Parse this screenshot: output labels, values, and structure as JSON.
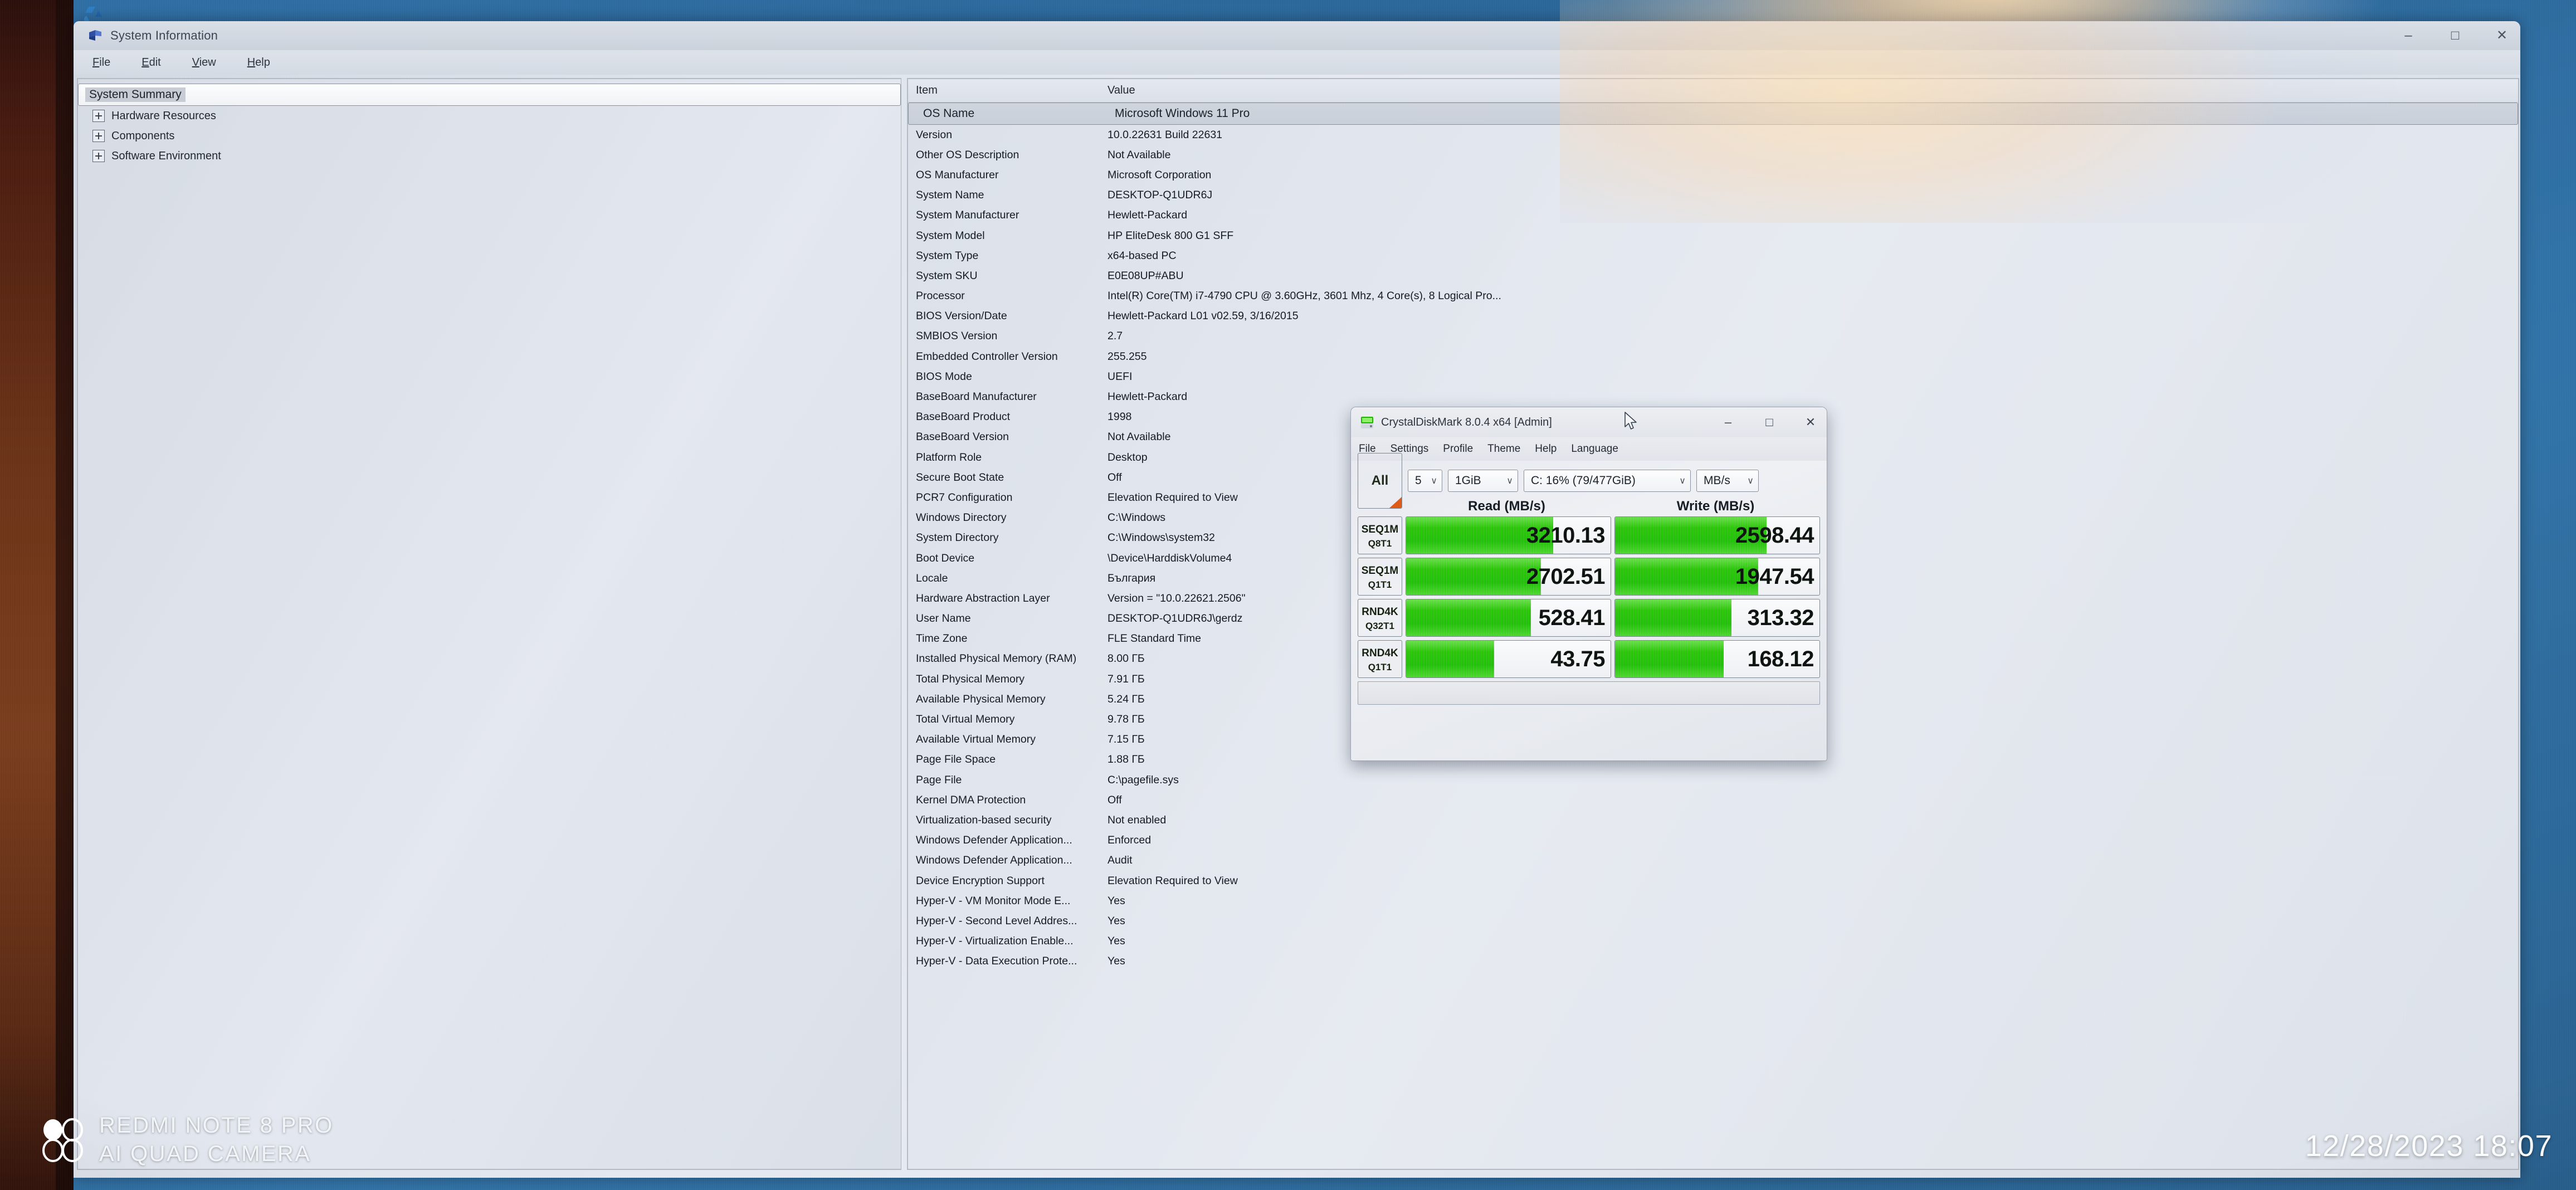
{
  "photo": {
    "watermark": {
      "line1": "REDMI NOTE 8 PRO",
      "line2": "AI QUAD CAMERA"
    },
    "timestamp": "12/28/2023 18:07",
    "desktop": {
      "recycle_bin_label": ""
    }
  },
  "sysinfo": {
    "title": "System Information",
    "menu": [
      {
        "label": "File",
        "accel": "F"
      },
      {
        "label": "Edit",
        "accel": "E"
      },
      {
        "label": "View",
        "accel": "V"
      },
      {
        "label": "Help",
        "accel": "H"
      }
    ],
    "window_controls": {
      "minimize": "–",
      "maximize": "□",
      "close": "✕"
    },
    "tree": [
      {
        "label": "System Summary",
        "selected": true,
        "expandable": false
      },
      {
        "label": "Hardware Resources",
        "selected": false,
        "expandable": true
      },
      {
        "label": "Components",
        "selected": false,
        "expandable": true
      },
      {
        "label": "Software Environment",
        "selected": false,
        "expandable": true
      }
    ],
    "columns": [
      "Item",
      "Value"
    ],
    "rows": [
      {
        "item": "OS Name",
        "value": "Microsoft Windows 11 Pro",
        "selected": true
      },
      {
        "item": "Version",
        "value": "10.0.22631 Build 22631"
      },
      {
        "item": "Other OS Description",
        "value": "Not Available"
      },
      {
        "item": "OS Manufacturer",
        "value": "Microsoft Corporation"
      },
      {
        "item": "System Name",
        "value": "DESKTOP-Q1UDR6J"
      },
      {
        "item": "System Manufacturer",
        "value": "Hewlett-Packard"
      },
      {
        "item": "System Model",
        "value": "HP EliteDesk 800 G1 SFF"
      },
      {
        "item": "System Type",
        "value": "x64-based PC"
      },
      {
        "item": "System SKU",
        "value": "E0E08UP#ABU"
      },
      {
        "item": "Processor",
        "value": "Intel(R) Core(TM) i7-4790 CPU @ 3.60GHz, 3601 Mhz, 4 Core(s), 8 Logical Pro..."
      },
      {
        "item": "BIOS Version/Date",
        "value": "Hewlett-Packard L01 v02.59, 3/16/2015"
      },
      {
        "item": "SMBIOS Version",
        "value": "2.7"
      },
      {
        "item": "Embedded Controller Version",
        "value": "255.255"
      },
      {
        "item": "BIOS Mode",
        "value": "UEFI"
      },
      {
        "item": "BaseBoard Manufacturer",
        "value": "Hewlett-Packard"
      },
      {
        "item": "BaseBoard Product",
        "value": "1998"
      },
      {
        "item": "BaseBoard Version",
        "value": "Not Available"
      },
      {
        "item": "Platform Role",
        "value": "Desktop"
      },
      {
        "item": "Secure Boot State",
        "value": "Off"
      },
      {
        "item": "PCR7 Configuration",
        "value": "Elevation Required to View"
      },
      {
        "item": "Windows Directory",
        "value": "C:\\Windows"
      },
      {
        "item": "System Directory",
        "value": "C:\\Windows\\system32"
      },
      {
        "item": "Boot Device",
        "value": "\\Device\\HarddiskVolume4"
      },
      {
        "item": "Locale",
        "value": "България"
      },
      {
        "item": "Hardware Abstraction Layer",
        "value": "Version = \"10.0.22621.2506\""
      },
      {
        "item": "User Name",
        "value": "DESKTOP-Q1UDR6J\\gerdz"
      },
      {
        "item": "Time Zone",
        "value": "FLE Standard Time"
      },
      {
        "item": "Installed Physical Memory (RAM)",
        "value": "8.00 ГБ"
      },
      {
        "item": "Total Physical Memory",
        "value": "7.91 ГБ"
      },
      {
        "item": "Available Physical Memory",
        "value": "5.24 ГБ"
      },
      {
        "item": "Total Virtual Memory",
        "value": "9.78 ГБ"
      },
      {
        "item": "Available Virtual Memory",
        "value": "7.15 ГБ"
      },
      {
        "item": "Page File Space",
        "value": "1.88 ГБ"
      },
      {
        "item": "Page File",
        "value": "C:\\pagefile.sys"
      },
      {
        "item": "Kernel DMA Protection",
        "value": "Off"
      },
      {
        "item": "Virtualization-based security",
        "value": "Not enabled"
      },
      {
        "item": "Windows Defender Application...",
        "value": "Enforced"
      },
      {
        "item": "Windows Defender Application...",
        "value": "Audit"
      },
      {
        "item": "Device Encryption Support",
        "value": "Elevation Required to View"
      },
      {
        "item": "Hyper-V - VM Monitor Mode E...",
        "value": "Yes"
      },
      {
        "item": "Hyper-V - Second Level Addres...",
        "value": "Yes"
      },
      {
        "item": "Hyper-V - Virtualization Enable...",
        "value": "Yes"
      },
      {
        "item": "Hyper-V - Data Execution Prote...",
        "value": "Yes"
      }
    ]
  },
  "crystaldiskmark": {
    "title": "CrystalDiskMark 8.0.4 x64 [Admin]",
    "menu": [
      "File",
      "Settings",
      "Profile",
      "Theme",
      "Help",
      "Language"
    ],
    "window_controls": {
      "minimize": "–",
      "maximize": "□",
      "close": "✕"
    },
    "toolbar": {
      "all_button": "All",
      "count": "5",
      "size": "1GiB",
      "drive": "C: 16% (79/477GiB)",
      "unit": "MB/s",
      "chevron": "∨"
    },
    "headers": {
      "read": "Read (MB/s)",
      "write": "Write (MB/s)"
    },
    "chart_data": {
      "type": "bar",
      "title": "CrystalDiskMark 8.0.4 x64 results",
      "unit": "MB/s",
      "categories": [
        "SEQ1M Q8T1",
        "SEQ1M Q1T1",
        "RND4K Q32T1",
        "RND4K Q1T1"
      ],
      "series": [
        {
          "name": "Read (MB/s)",
          "values": [
            3210.13,
            2702.51,
            528.41,
            43.75
          ]
        },
        {
          "name": "Write (MB/s)",
          "values": [
            2598.44,
            1947.54,
            313.32,
            168.12
          ]
        }
      ],
      "bar_fill_percent": {
        "read": [
          72,
          66,
          61,
          43
        ],
        "write": [
          74,
          70,
          57,
          53
        ]
      },
      "legend": "none",
      "grid": false
    },
    "rows": [
      {
        "t1": "SEQ1M",
        "t2": "Q8T1",
        "read": "3210.13",
        "write": "2598.44",
        "read_fill": 72,
        "write_fill": 74
      },
      {
        "t1": "SEQ1M",
        "t2": "Q1T1",
        "read": "2702.51",
        "write": "1947.54",
        "read_fill": 66,
        "write_fill": 70
      },
      {
        "t1": "RND4K",
        "t2": "Q32T1",
        "read": "528.41",
        "write": "313.32",
        "read_fill": 61,
        "write_fill": 57
      },
      {
        "t1": "RND4K",
        "t2": "Q1T1",
        "read": "43.75",
        "write": "168.12",
        "read_fill": 43,
        "write_fill": 53
      }
    ],
    "status": ""
  },
  "colors": {
    "green": "#22c200",
    "orange": "#e05a14",
    "desktop_blue": "#2f6ea4",
    "window_gray": "#dee3ec"
  }
}
